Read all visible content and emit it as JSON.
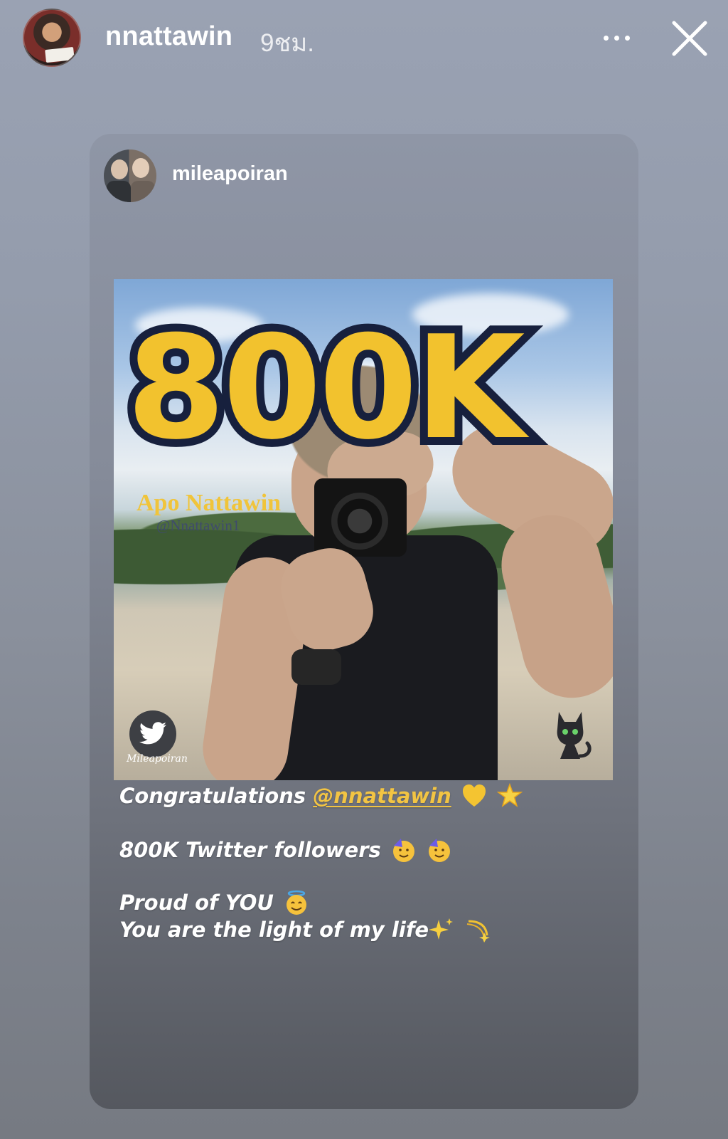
{
  "story": {
    "username": "nnattawin",
    "time": "9ชม."
  },
  "post": {
    "username": "mileapoiran",
    "image": {
      "headline": "800K",
      "name": "Apo Nattawin",
      "handle": "@Nnattawin1",
      "signature": "Mileapoiran"
    },
    "caption": {
      "line1_prefix": "Congratulations ",
      "line1_mention": "@nnattawin",
      "line2": "800K Twitter followers",
      "line3": "Proud of  YOU",
      "line4": "You are the light of my life"
    }
  },
  "icons": {
    "more": "more-horizontal-icon",
    "close": "close-icon",
    "twitter": "twitter-bird-icon",
    "cat": "black-cat-icon",
    "yellow_heart": "yellow-heart-emoji",
    "sparkle_star": "glowing-star-emoji",
    "party_face": "partying-face-emoji",
    "angel_face": "smiling-face-halo-emoji",
    "sparkles": "sparkles-emoji",
    "dizzy": "dizzy-emoji"
  },
  "colors": {
    "mention": "#f2c443",
    "headline_fill": "#f2c22e",
    "headline_outline": "#17203d",
    "text": "#ffffff"
  }
}
